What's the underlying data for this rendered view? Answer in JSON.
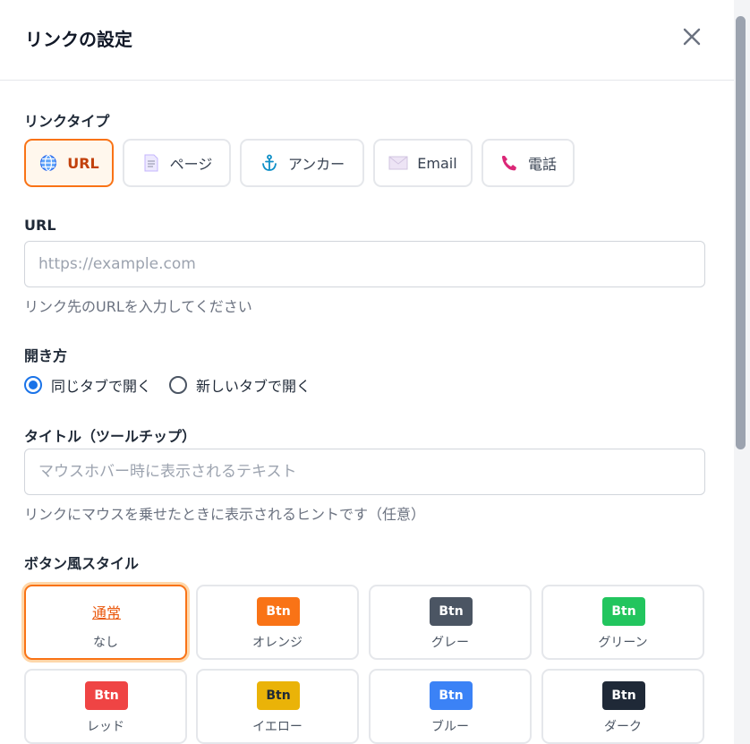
{
  "dialog": {
    "title": "リンクの設定"
  },
  "link_type": {
    "label": "リンクタイプ",
    "options": [
      {
        "label": "URL",
        "icon": "globe-icon"
      },
      {
        "label": "ページ",
        "icon": "page-icon"
      },
      {
        "label": "アンカー",
        "icon": "anchor-icon"
      },
      {
        "label": "Email",
        "icon": "envelope-icon"
      },
      {
        "label": "電話",
        "icon": "phone-icon"
      }
    ],
    "selected": "URL"
  },
  "url_field": {
    "label": "URL",
    "placeholder": "https://example.com",
    "value": "",
    "hint": "リンク先のURLを入力してください"
  },
  "open_method": {
    "label": "開き方",
    "options": [
      "同じタブで開く",
      "新しいタブで開く"
    ],
    "selected": "同じタブで開く"
  },
  "title_field": {
    "label": "タイトル（ツールチップ）",
    "placeholder": "マウスホバー時に表示されるテキスト",
    "value": "",
    "hint": "リンクにマウスを乗せたときに表示されるヒントです（任意）"
  },
  "button_style": {
    "label": "ボタン風スタイル",
    "selected": "なし",
    "options": [
      {
        "preview": "通常",
        "name": "なし",
        "color": ""
      },
      {
        "preview": "Btn",
        "name": "オレンジ",
        "color": "#f97316"
      },
      {
        "preview": "Btn",
        "name": "グレー",
        "color": "#4b5563"
      },
      {
        "preview": "Btn",
        "name": "グリーン",
        "color": "#22c55e"
      },
      {
        "preview": "Btn",
        "name": "レッド",
        "color": "#ef4444"
      },
      {
        "preview": "Btn",
        "name": "イエロー",
        "color": "#eab308"
      },
      {
        "preview": "Btn",
        "name": "ブルー",
        "color": "#3b82f6"
      },
      {
        "preview": "Btn",
        "name": "ダーク",
        "color": "#1f2937"
      }
    ]
  },
  "colors": {
    "accent": "#f97316",
    "accent_text": "#c2410c",
    "radio": "#1a73e8"
  }
}
